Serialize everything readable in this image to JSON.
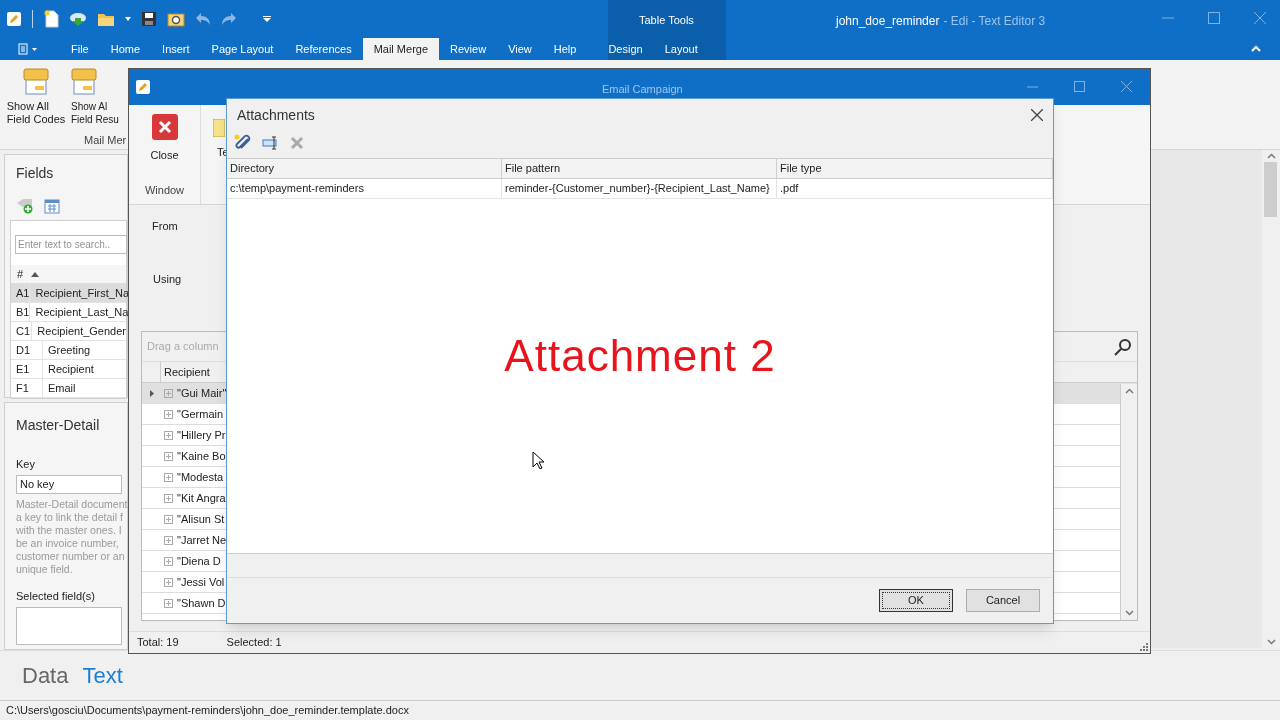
{
  "window": {
    "document": "john_doe_reminder",
    "app": "- Edi - Text Editor 3"
  },
  "context_group": "Table Tools",
  "tabs": [
    {
      "label": "File",
      "selected": false
    },
    {
      "label": "Home",
      "selected": false
    },
    {
      "label": "Insert",
      "selected": false
    },
    {
      "label": "Page Layout",
      "selected": false
    },
    {
      "label": "References",
      "selected": false
    },
    {
      "label": "Mail Merge",
      "selected": true
    },
    {
      "label": "Review",
      "selected": false
    },
    {
      "label": "View",
      "selected": false
    },
    {
      "label": "Help",
      "selected": false
    },
    {
      "label": "Design",
      "selected": false
    },
    {
      "label": "Layout",
      "selected": false
    }
  ],
  "ribbon": {
    "buttons": [
      "Show All\nField Codes",
      "Show Al\nField Resu"
    ],
    "group_label": "Mail Mer"
  },
  "fields_panel": {
    "title": "Fields",
    "search_placeholder": "Enter text to search..",
    "column": "#",
    "rows": [
      {
        "id": "A1",
        "name": "Recipient_First_Na",
        "selected": true
      },
      {
        "id": "B1",
        "name": "Recipient_Last_Na",
        "selected": false
      },
      {
        "id": "C1",
        "name": "Recipient_Gender",
        "selected": false
      },
      {
        "id": "D1",
        "name": "Greeting",
        "selected": false
      },
      {
        "id": "E1",
        "name": "Recipient",
        "selected": false
      },
      {
        "id": "F1",
        "name": "Email",
        "selected": false
      }
    ]
  },
  "master_detail": {
    "title": "Master-Detail",
    "key_label": "Key",
    "key_value": "No key",
    "description_lines": [
      "Master-Detail document",
      "a key to link the detail f",
      "with the master ones. I",
      "be an invoice number,",
      "customer number or an",
      "unique field."
    ],
    "selected_label": "Selected field(s)"
  },
  "email_window": {
    "title": "Email Campaign",
    "close_label": "Close",
    "cut_button": "Te",
    "group_label": "Window",
    "from_label": "From",
    "using_label": "Using",
    "group_hint": "Drag a column",
    "column": "Recipient",
    "rows": [
      {
        "text": "\"Gui Mair\"",
        "selected": true
      },
      {
        "text": "\"Germain",
        "selected": false
      },
      {
        "text": "\"Hillery Pr",
        "selected": false
      },
      {
        "text": "\"Kaine Bo",
        "selected": false
      },
      {
        "text": "\"Modesta",
        "selected": false
      },
      {
        "text": "\"Kit Angra",
        "selected": false
      },
      {
        "text": "\"Alisun St",
        "selected": false
      },
      {
        "text": "\"Jarret Ne",
        "selected": false
      },
      {
        "text": "\"Diena D",
        "selected": false
      },
      {
        "text": "\"Jessi Vol",
        "selected": false
      },
      {
        "text": "\"Shawn D",
        "selected": false
      }
    ],
    "total": "Total: 19",
    "selected_count": "Selected: 1"
  },
  "attachments": {
    "title": "Attachments",
    "columns": [
      "Directory",
      "File pattern",
      "File type"
    ],
    "rows": [
      [
        "c:\\temp\\payment-reminders",
        "reminder-{Customer_number}-{Recipient_Last_Name}",
        ".pdf"
      ]
    ],
    "caption": "Attachment 2",
    "buttons": [
      {
        "label": "OK",
        "default": true
      },
      {
        "label": "Cancel",
        "default": false
      }
    ]
  },
  "bottom_tabs": [
    {
      "label": "Data",
      "selected": false
    },
    {
      "label": "Text",
      "selected": true
    }
  ],
  "status_path": "C:\\Users\\gosciu\\Documents\\payment-reminders\\john_doe_reminder.template.docx"
}
